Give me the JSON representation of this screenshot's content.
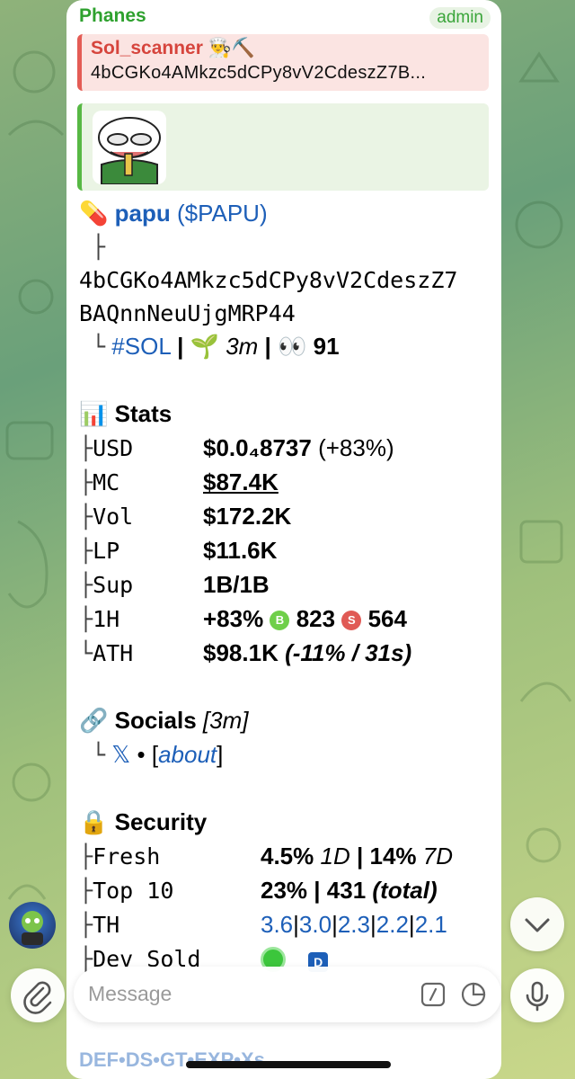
{
  "message": {
    "sender": "Phanes",
    "role_badge": "admin",
    "reply": {
      "name": "Sol_scanner 👨‍🍳⛏️",
      "text": "4bCGKo4AMkzc5dCPy8vV2CdeszZ7B..."
    },
    "token": {
      "emoji": "💊",
      "name": "papu",
      "ticker": "($PAPU)",
      "tree_mid": "├",
      "address_line1": "4bCGKo4AMkzc5dCPy8vV2CdeszZ7",
      "address_line2": "BAQnnNeuUjgMRP44",
      "tree_end": "└",
      "chain": "#SOL",
      "sep": "|",
      "age_icon": "🌱",
      "age": "3m",
      "views_icon": "👀",
      "views": "91"
    },
    "stats": {
      "icon": "📊",
      "title": "Stats",
      "rows": [
        {
          "tree": "├",
          "label": "USD",
          "value": "$0.0₄8737",
          "extra": "(+83%)"
        },
        {
          "tree": "├",
          "label": "MC",
          "value": "$87.4K",
          "extra": ""
        },
        {
          "tree": "├",
          "label": "Vol",
          "value": "$172.2K",
          "extra": ""
        },
        {
          "tree": "├",
          "label": "LP",
          "value": "$11.6K",
          "extra": ""
        },
        {
          "tree": "├",
          "label": "Sup",
          "value": "1B/1B",
          "extra": ""
        },
        {
          "tree": "├",
          "label": "1H",
          "value": "+83%",
          "extra": ""
        },
        {
          "tree": "└",
          "label": "ATH",
          "value": "$98.1K",
          "extra": "(-11% / 31s)"
        }
      ],
      "buy_badge": "B",
      "buys": "823",
      "sell_badge": "S",
      "sells": "564"
    },
    "socials": {
      "icon": "🔗",
      "title": "Socials",
      "age": "[3m]",
      "tree": "└",
      "x_icon": "𝕏",
      "bullet": "•",
      "about": "about",
      "lb": "[",
      "rb": "]"
    },
    "security": {
      "icon": "🔒",
      "title": "Security",
      "fresh": {
        "tree": "├",
        "label": "Fresh",
        "v1": "4.5%",
        "p1": "1D",
        "sep": "|",
        "v2": "14%",
        "p2": "7D"
      },
      "top10": {
        "tree": "├",
        "label": "Top 10",
        "v1": "23%",
        "sep": "|",
        "v2": "431",
        "note": "(total)"
      },
      "th": {
        "tree": "├",
        "label": "TH",
        "values": [
          "3.6",
          "3.0",
          "2.3",
          "2.2",
          "2.1"
        ],
        "sep": "|"
      },
      "dev": {
        "tree": "├",
        "label": "Dev Sold",
        "badge": "D"
      }
    },
    "bottom_links": "DEF•DS•GT•EXP•Xs"
  },
  "composer": {
    "placeholder": "Message"
  },
  "icons": {
    "attach": "paperclip-icon",
    "commands": "slash-command-icon",
    "sticker": "sticker-icon",
    "mic": "microphone-icon",
    "scroll": "chevron-down-icon"
  },
  "colors": {
    "sender": "#2ea12e",
    "reply_accent": "#e45c55",
    "link_blue": "#1d5fb8",
    "buy_green": "#6fcf4a",
    "sell_red": "#e05a55",
    "dev_dot": "#3cc63c"
  }
}
